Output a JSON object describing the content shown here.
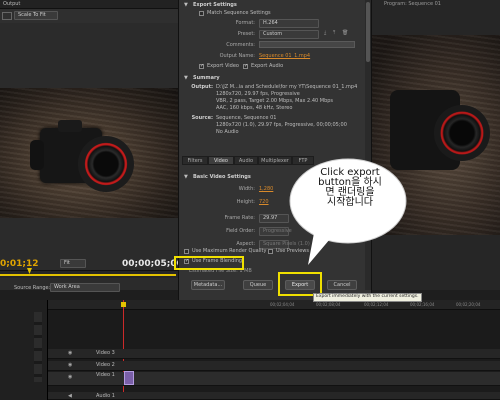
{
  "left_panel": {
    "tab_title": "Output",
    "scale_select": "Scale To Fit",
    "source_range_label": "Source Range:",
    "source_range_value": "Work Area",
    "fit_select": "Fit",
    "timecode_current": "0;01;12",
    "timecode_duration": "00;00;05;00"
  },
  "right_panel": {
    "tab_title": "Program: Sequence 01"
  },
  "export_settings": {
    "header": "Export Settings",
    "match_sequence_label": "Match Sequence Settings",
    "format_label": "Format:",
    "format_value": "H.264",
    "preset_label": "Preset:",
    "preset_value": "Custom",
    "comments_label": "Comments:",
    "comments_value": "",
    "output_name_label": "Output Name:",
    "output_name_value": "Sequence 01_1.mp4",
    "export_video_label": "Export Video",
    "export_audio_label": "Export Audio"
  },
  "summary": {
    "header": "Summary",
    "output_label": "Output:",
    "output_lines": [
      "D:\\JZ M...ia and Schedule\\for my YT\\Sequence 01_1.mp4",
      "1280x720, 29.97 fps, Progressive",
      "VBR, 2 pass, Target 2.00 Mbps, Max 2.40 Mbps",
      "AAC, 160 kbps, 48 kHz, Stereo"
    ],
    "source_label": "Source:",
    "source_lines": [
      "Sequence, Sequence 01",
      "1280x720 (1.0), 29.97 fps, Progressive, 00;00;05;00",
      "No Audio"
    ]
  },
  "tabs": [
    "Filters",
    "Video",
    "Audio",
    "Multiplexer",
    "FTP"
  ],
  "active_tab": "Video",
  "basic_video": {
    "header": "Basic Video Settings",
    "width_label": "Width:",
    "width_value": "1,280",
    "height_label": "Height:",
    "height_value": "720",
    "frame_rate_label": "Frame Rate:",
    "frame_rate_value": "29.97",
    "field_order_label": "Field Order:",
    "field_order_value": "Progressive",
    "aspect_label": "Aspect:",
    "aspect_value": "Square Pixels (1.0)"
  },
  "options": {
    "max_render_quality": "Use Maximum Render Quality",
    "use_previews": "Use Previews",
    "frame_blending": "Use Frame Blending",
    "estimated_file_size": "Estimated File Size: 1 MB"
  },
  "buttons": {
    "metadata": "Metadata...",
    "queue": "Queue",
    "export": "Export",
    "cancel": "Cancel"
  },
  "tooltip": "Export immediately with the current settings.",
  "callout": {
    "lines": [
      "Click export",
      "button을 하시",
      "면 랜더링을",
      "시작합니다"
    ]
  },
  "timeline": {
    "tracks": [
      "Video 3",
      "Video 2",
      "Video 1",
      "Audio 1"
    ],
    "ruler_labels": [
      "00;02;04;04",
      "00;02;08;04",
      "00;02;12;04",
      "00;02;16;04",
      "00;02;20;04"
    ]
  },
  "colors": {
    "accent_orange": "#d98a2b",
    "highlight_yellow": "#f0e000",
    "timecode_yellow": "#e0a400"
  }
}
